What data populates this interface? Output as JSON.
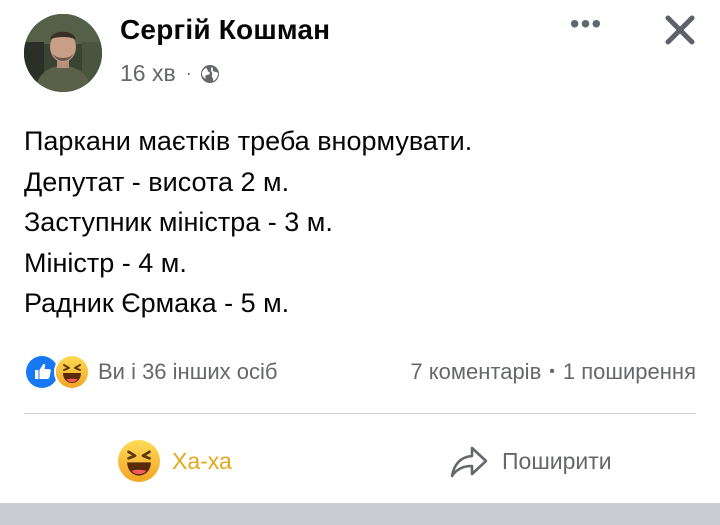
{
  "post": {
    "author": "Сергій Кошман",
    "time": "16 хв",
    "audience_icon": "globe-icon",
    "text_lines": [
      "Паркани маєтків треба внормувати.",
      "Депутат - висота 2 м.",
      "Заступник міністра - 3 м.",
      "Міністр - 4 м.",
      "Радник Єрмака - 5 м."
    ]
  },
  "stats": {
    "reaction_icons": [
      "like-icon",
      "haha-icon"
    ],
    "reactions_label": "Ви і 36 інших осіб",
    "comments": "7 коментарів",
    "separator": "•",
    "shares": "1 поширення"
  },
  "actions": {
    "haha_label": "Ха-ха",
    "share_label": "Поширити"
  },
  "colors": {
    "like_blue": "#1877f2",
    "haha_yellow": "#f7b125",
    "haha_text": "#e4a81b",
    "secondary_text": "#65676b"
  }
}
